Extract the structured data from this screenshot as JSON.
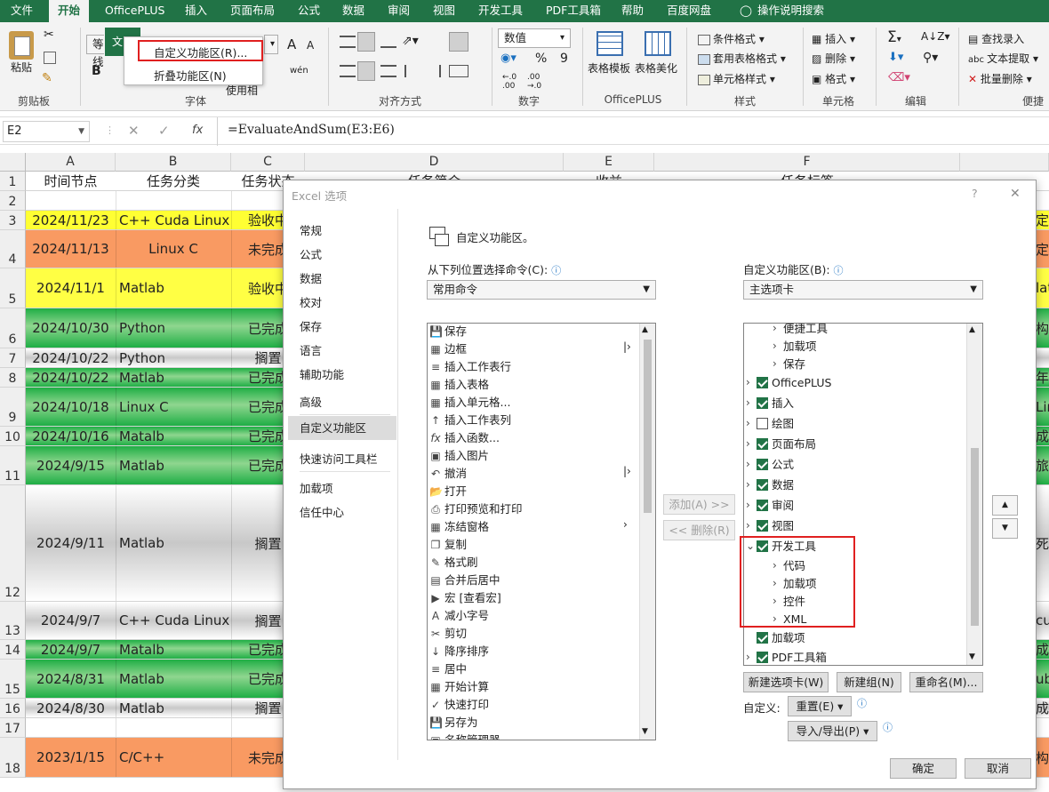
{
  "menu": {
    "tabs": [
      "文件",
      "开始",
      "OfficePLUS",
      "插入",
      "页面布局",
      "公式",
      "数据",
      "审阅",
      "视图",
      "开发工具",
      "PDF工具箱",
      "帮助",
      "百度网盘",
      "操作说明搜索"
    ],
    "active": "开始"
  },
  "ribbon": {
    "clipboard_label": "剪贴板",
    "paste_label": "粘贴",
    "font_label": "字体",
    "font_name": "等线",
    "use_label": "使用相",
    "align_label": "对齐方式",
    "number_label": "数字",
    "number_format": "数值",
    "officeplus_label": "OfficePLUS",
    "table_template": "表格模板",
    "table_beautify": "表格美化",
    "style_label": "样式",
    "cond_format": "条件格式",
    "table_format": "套用表格格式",
    "cell_style": "单元格样式",
    "cells_label": "单元格",
    "insert": "插入",
    "delete": "删除",
    "format": "格式",
    "edit_label": "编辑",
    "find_insert": "查找录入",
    "text_extract": "文本提取",
    "batch_delete": "批量删除",
    "convenient_label": "便捷",
    "font_file_hint": "文",
    "percent": "%",
    "comma": "9",
    "font_size_up": "A",
    "font_size_down": "A",
    "bold": "B",
    "wen": "wén"
  },
  "popup": {
    "item1": "自定义功能区(R)...",
    "item2": "折叠功能区(N)"
  },
  "formula": {
    "namebox": "E2",
    "fx": "fx",
    "formula": "=EvaluateAndSum(E3:E6)"
  },
  "sheet": {
    "columns": [
      "A",
      "B",
      "C",
      "D",
      "E",
      "F"
    ],
    "header_row": [
      "时间节点",
      "任务分类",
      "任务状态",
      "任务简介",
      "收益",
      "任务标签"
    ],
    "rows": [
      {
        "n": "1"
      },
      {
        "n": "2",
        "a": "",
        "b": "",
        "c": ""
      },
      {
        "n": "3",
        "a": "2024/11/23",
        "b": "C++ Cuda Linux",
        "c": "验收中",
        "bg": "#ffff33",
        "right": "定"
      },
      {
        "n": "4",
        "a": "2024/11/13",
        "b": "Linux C",
        "c": "未完成",
        "bg": "#f99a62",
        "right": "定"
      },
      {
        "n": "5",
        "a": "2024/11/1",
        "b": "Matlab",
        "c": "验收中",
        "bg": "#ffff44",
        "right": "lat"
      },
      {
        "n": "6",
        "a": "2024/10/30",
        "b": "Python",
        "c": "已完成",
        "bg": "grad-green",
        "right": "构"
      },
      {
        "n": "7",
        "a": "2024/10/22",
        "b": "Python",
        "c": "搁置",
        "bg": "grad-gray",
        "right": ""
      },
      {
        "n": "8",
        "a": "2024/10/22",
        "b": "Matlab",
        "c": "已完成",
        "bg": "grad-green",
        "right": "年"
      },
      {
        "n": "9",
        "a": "2024/10/18",
        "b": "Linux C",
        "c": "已完成",
        "bg": "grad-green",
        "right": "Lir"
      },
      {
        "n": "10",
        "a": "2024/10/16",
        "b": "Matalb",
        "c": "已完成",
        "bg": "grad-green",
        "right": "成"
      },
      {
        "n": "11",
        "a": "2024/9/15",
        "b": "Matlab",
        "c": "已完成",
        "bg": "grad-green",
        "right": "旅"
      },
      {
        "n": "12",
        "a": "2024/9/11",
        "b": "Matlab",
        "c": "搁置",
        "bg": "grad-gray",
        "right": "死"
      },
      {
        "n": "13",
        "a": "2024/9/7",
        "b": "C++ Cuda Linux",
        "c": "搁置",
        "bg": "grad-gray",
        "right": "cu"
      },
      {
        "n": "14",
        "a": "2024/9/7",
        "b": "Matalb",
        "c": "已完成",
        "bg": "grad-green",
        "right": "成"
      },
      {
        "n": "15",
        "a": "2024/8/31",
        "b": "Matlab",
        "c": "已完成",
        "bg": "grad-green",
        "right": "ub"
      },
      {
        "n": "16",
        "a": "2024/8/30",
        "b": "Matlab",
        "c": "搁置",
        "bg": "grad-gray",
        "right": "成"
      },
      {
        "n": "17",
        "a": "",
        "b": "",
        "c": ""
      },
      {
        "n": "18",
        "a": "2023/1/15",
        "b": "C/C++",
        "c": "未完成",
        "bg": "#f99a62",
        "right": "构"
      }
    ]
  },
  "dialog": {
    "title": "Excel 选项",
    "help": "?",
    "close": "✕",
    "nav": [
      "常规",
      "公式",
      "数据",
      "校对",
      "保存",
      "语言",
      "辅助功能",
      "高级",
      "自定义功能区",
      "快速访问工具栏",
      "加载项",
      "信任中心"
    ],
    "nav_selected": "自定义功能区",
    "heading": "自定义功能区。",
    "left_label": "从下列位置选择命令(C):",
    "left_combo": "常用命令",
    "right_label": "自定义功能区(B):",
    "right_combo": "主选项卡",
    "commands": [
      "保存",
      "边框",
      "插入工作表行",
      "插入表格",
      "插入单元格...",
      "插入工作表列",
      "插入函数...",
      "插入图片",
      "撤消",
      "打开",
      "打印预览和打印",
      "冻结窗格",
      "复制",
      "格式刷",
      "合并后居中",
      "宏 [查看宏]",
      "减小字号",
      "剪切",
      "降序排序",
      "居中",
      "开始计算",
      "快速打印",
      "另存为",
      "名称管理器"
    ],
    "add_btn": "添加(A) >>",
    "remove_btn": "<< 删除(R)",
    "tree": [
      {
        "label": "便捷工具",
        "level": 2,
        "check": null
      },
      {
        "label": "加载项",
        "level": 2,
        "check": null
      },
      {
        "label": "保存",
        "level": 2,
        "check": null
      },
      {
        "label": "OfficePLUS",
        "level": 1,
        "check": true
      },
      {
        "label": "插入",
        "level": 1,
        "check": true
      },
      {
        "label": "绘图",
        "level": 1,
        "check": false
      },
      {
        "label": "页面布局",
        "level": 1,
        "check": true
      },
      {
        "label": "公式",
        "level": 1,
        "check": true
      },
      {
        "label": "数据",
        "level": 1,
        "check": true
      },
      {
        "label": "审阅",
        "level": 1,
        "check": true
      },
      {
        "label": "视图",
        "level": 1,
        "check": true
      },
      {
        "label": "开发工具",
        "level": 1,
        "check": true,
        "expanded": true
      },
      {
        "label": "代码",
        "level": 2,
        "check": null
      },
      {
        "label": "加载项",
        "level": 2,
        "check": null
      },
      {
        "label": "控件",
        "level": 2,
        "check": null
      },
      {
        "label": "XML",
        "level": 2,
        "check": null
      },
      {
        "label": "加载项",
        "level": 1,
        "check": true,
        "noarrow": true
      },
      {
        "label": "PDF工具箱",
        "level": 1,
        "check": true
      }
    ],
    "new_tab": "新建选项卡(W)",
    "new_group": "新建组(N)",
    "rename": "重命名(M)...",
    "customize_label": "自定义:",
    "reset": "重置(E)",
    "import_export": "导入/导出(P)",
    "ok": "确定",
    "cancel": "取消"
  }
}
